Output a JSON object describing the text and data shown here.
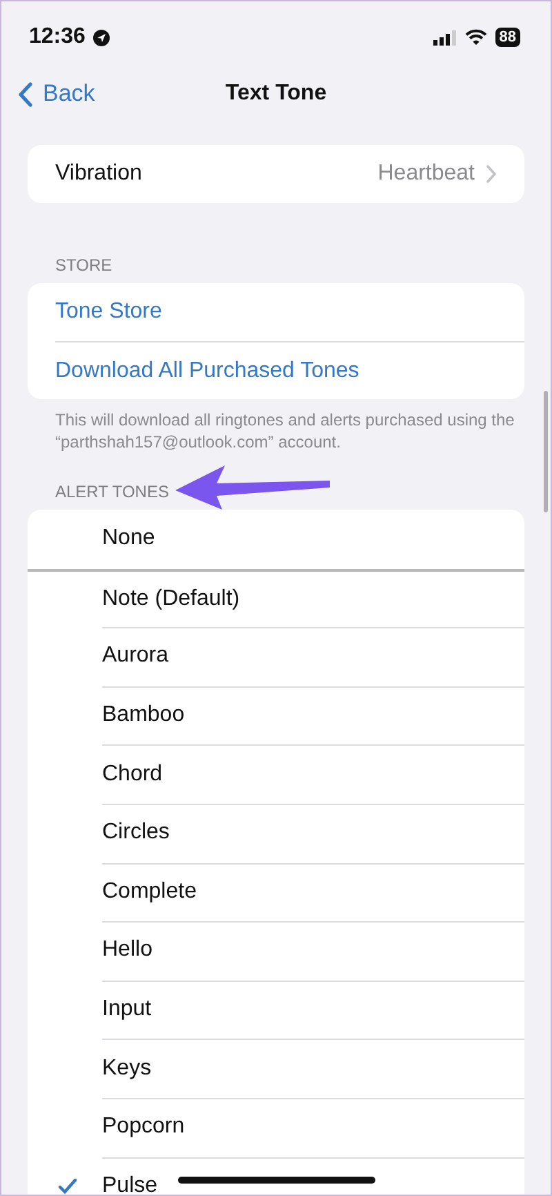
{
  "status_bar": {
    "time": "12:36",
    "battery": "88"
  },
  "nav": {
    "back": "Back",
    "title": "Text Tone"
  },
  "vibration": {
    "label": "Vibration",
    "value": "Heartbeat"
  },
  "store": {
    "header": "STORE",
    "links": [
      "Tone Store",
      "Download All Purchased Tones"
    ],
    "footer": "This will download all ringtones and alerts purchased using the “parthshah157@outlook.com” account."
  },
  "alert_tones": {
    "header": "ALERT TONES",
    "items": [
      {
        "label": "None",
        "selected": false
      },
      {
        "label": "Note (Default)",
        "selected": false
      },
      {
        "label": "Aurora",
        "selected": false
      },
      {
        "label": "Bamboo",
        "selected": false
      },
      {
        "label": "Chord",
        "selected": false
      },
      {
        "label": "Circles",
        "selected": false
      },
      {
        "label": "Complete",
        "selected": false
      },
      {
        "label": "Hello",
        "selected": false
      },
      {
        "label": "Input",
        "selected": false
      },
      {
        "label": "Keys",
        "selected": false
      },
      {
        "label": "Popcorn",
        "selected": false
      },
      {
        "label": "Pulse",
        "selected": true
      }
    ]
  }
}
